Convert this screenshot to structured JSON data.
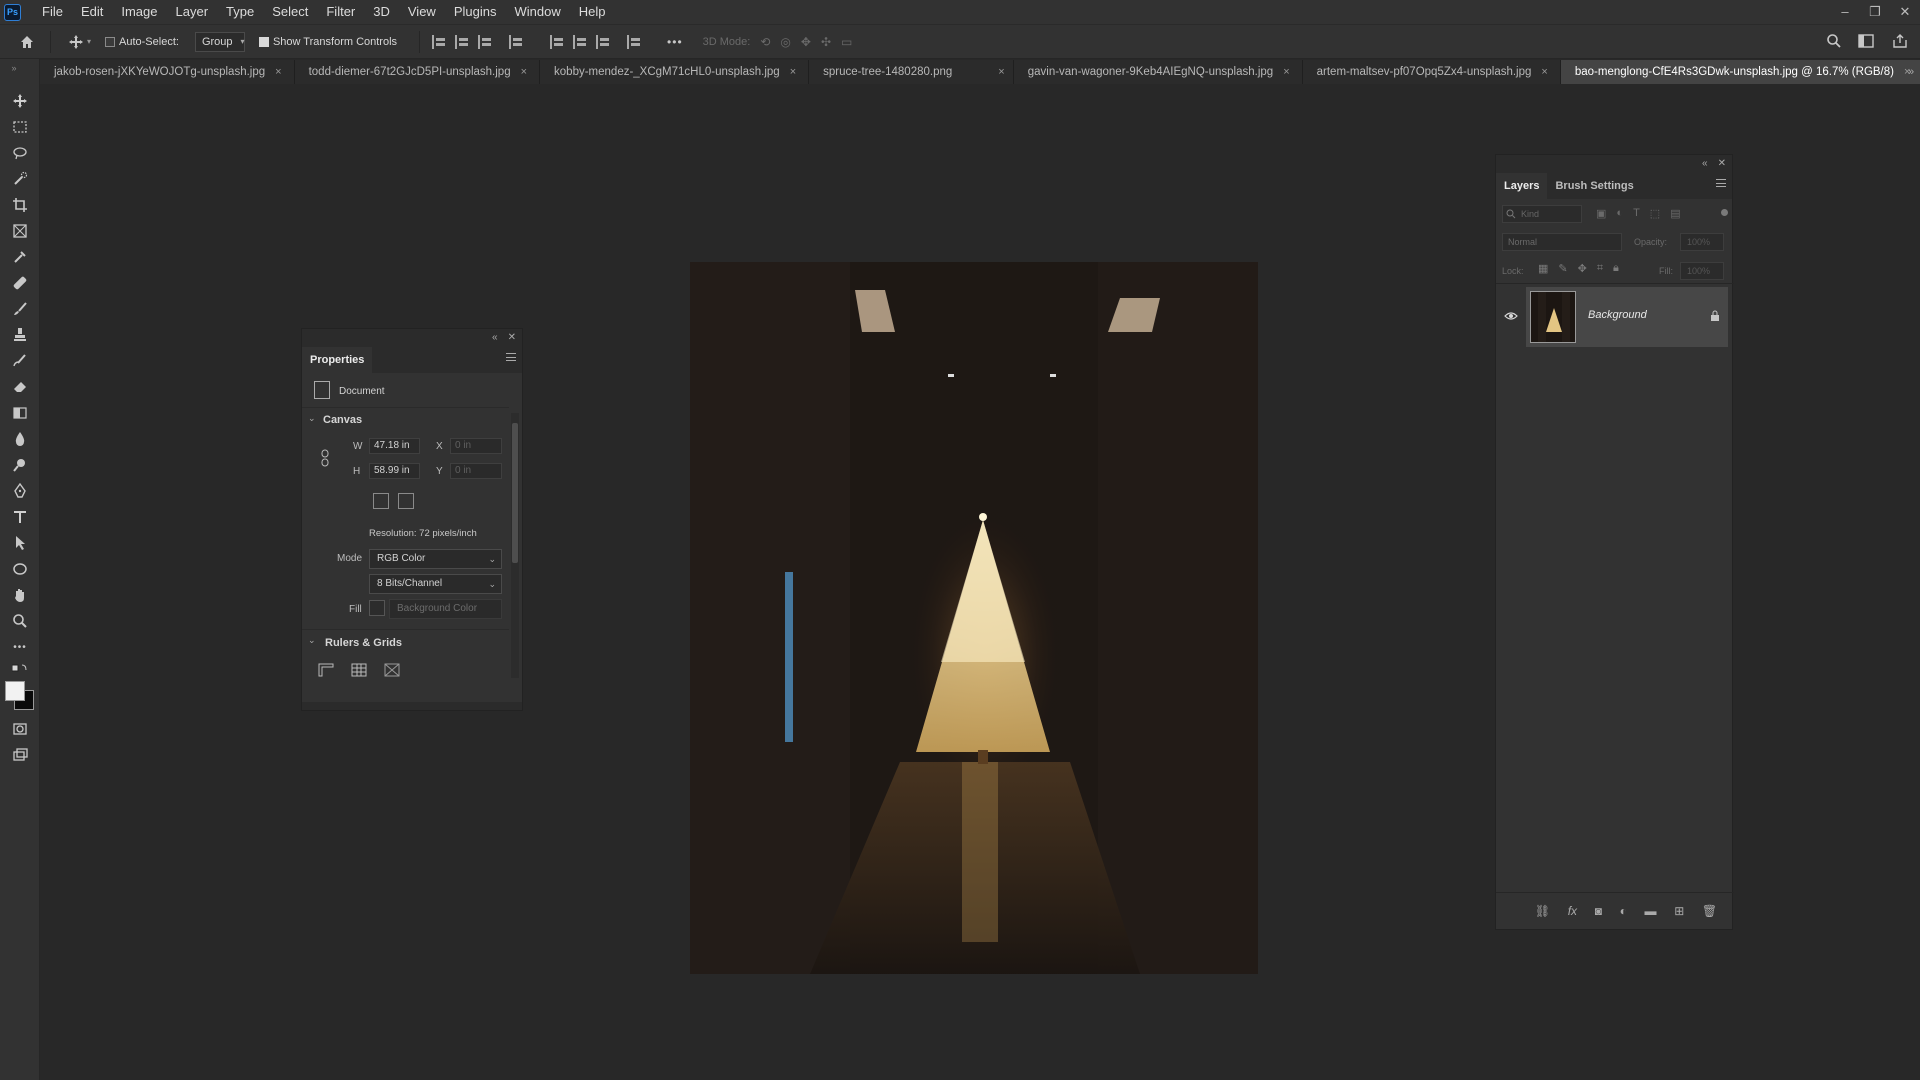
{
  "app": {
    "logo_text": "Ps"
  },
  "menu": [
    "File",
    "Edit",
    "Image",
    "Layer",
    "Type",
    "Select",
    "Filter",
    "3D",
    "View",
    "Plugins",
    "Window",
    "Help"
  ],
  "window_controls": {
    "minimize": "–",
    "restore": "❐",
    "close": "✕"
  },
  "options_bar": {
    "auto_select_label": "Auto-Select:",
    "auto_select_checked": false,
    "auto_select_target": "Group",
    "show_transform_label": "Show Transform Controls",
    "show_transform_checked": true,
    "more_label": "•••",
    "mode_3d_label": "3D Mode:"
  },
  "tabs": [
    {
      "label": "jakob-rosen-jXKYeWOJOTg-unsplash.jpg",
      "active": false
    },
    {
      "label": "todd-diemer-67t2GJcD5PI-unsplash.jpg",
      "active": false
    },
    {
      "label": "kobby-mendez-_XCgM71cHL0-unsplash.jpg",
      "active": false
    },
    {
      "label": "spruce-tree-1480280.png",
      "active": false
    },
    {
      "label": "gavin-van-wagoner-9Keb4AIEgNQ-unsplash.jpg",
      "active": false
    },
    {
      "label": "artem-maltsev-pf07Opq5Zx4-unsplash.jpg",
      "active": false
    },
    {
      "label": "bao-menglong-CfE4Rs3GDwk-unsplash.jpg @ 16.7% (RGB/8)",
      "active": true
    }
  ],
  "close_glyph": "×",
  "properties": {
    "title": "Properties",
    "doc_label": "Document",
    "canvas_section": "Canvas",
    "w_label": "W",
    "w_value": "47.18 in",
    "h_label": "H",
    "h_value": "58.99 in",
    "x_label": "X",
    "x_value": "0 in",
    "y_label": "Y",
    "y_value": "0 in",
    "resolution": "Resolution: 72 pixels/inch",
    "mode_label": "Mode",
    "mode_value": "RGB Color",
    "bits_value": "8 Bits/Channel",
    "fill_label": "Fill",
    "fill_value": "Background Color",
    "rulers_section": "Rulers & Grids"
  },
  "layers": {
    "tab_layers": "Layers",
    "tab_brush": "Brush Settings",
    "filter_placeholder": "Kind",
    "blend_mode": "Normal",
    "opacity_label": "Opacity:",
    "opacity_value": "100%",
    "lock_label": "Lock:",
    "fill_label": "Fill:",
    "fill_value": "100%",
    "layer_name": "Background"
  },
  "colors": {
    "ui_dark": "#282828",
    "panel": "#323232",
    "active_tab": "#444444",
    "tree_glow": "#f2d89a"
  }
}
